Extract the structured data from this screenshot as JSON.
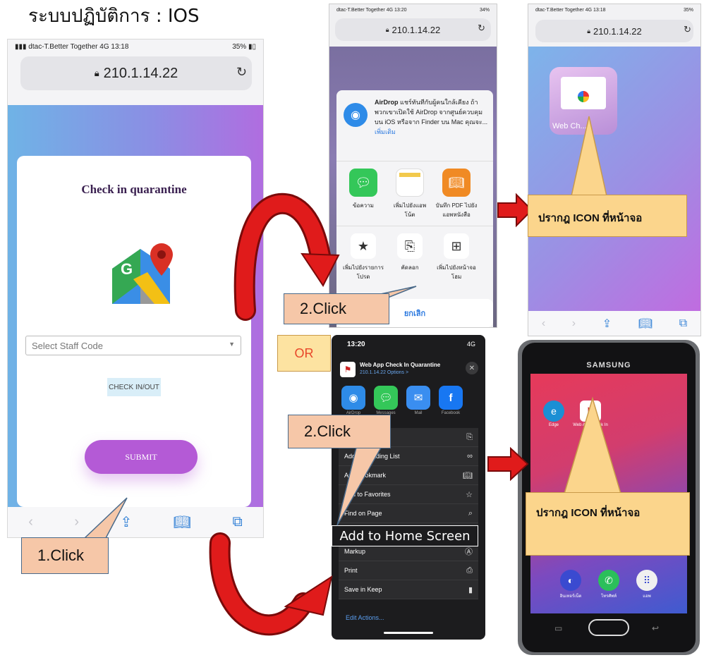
{
  "title": "ระบบปฏิบัติการ : IOS",
  "phone1": {
    "status": {
      "carrier": "dtac-T.Better Together",
      "network": "4G",
      "time": "13:18",
      "battery": "35%"
    },
    "url": "210.1.14.22",
    "card_title": "Check in quarantine",
    "select_placeholder": "Select Staff Code",
    "checkin_button": "CHECK IN/OUT",
    "submit_button": "SUBMIT"
  },
  "phone2": {
    "status": {
      "carrier": "dtac-T.Better Together",
      "network": "4G",
      "time": "13:20",
      "battery": "34%"
    },
    "url": "210.1.14.22",
    "airdrop_title": "AirDrop",
    "airdrop_text": "แชร์ทันทีกับผู้คนใกล้เคียง ถ้าพวกเขาเปิดใช้ AirDrop จากศูนย์ควบคุมบน iOS หรือจาก Finder บน Mac คุณจะ...",
    "airdrop_more": "เพิ่มเติม",
    "apps": [
      {
        "label": "ข้อความ",
        "icon": "messages-icon",
        "color": "#34c759"
      },
      {
        "label": "เพิ่มไปยังแอพโน้ต",
        "icon": "notes-icon",
        "color": "#f2c94c"
      },
      {
        "label": "บันทึก PDF ไปยังแอพหนังสือ",
        "icon": "books-icon",
        "color": "#f08a24"
      }
    ],
    "actions": [
      {
        "label": "เพิ่มไปยังรายการโปรด",
        "icon": "star-icon"
      },
      {
        "label": "คัดลอก",
        "icon": "copy-icon"
      },
      {
        "label": "เพิ่มไปยังหน้าจอโฮม",
        "icon": "add-square-icon"
      }
    ],
    "cancel": "ยกเลิก"
  },
  "phone3": {
    "status": {
      "carrier": "dtac-T.Better Together",
      "network": "4G",
      "time": "13:18",
      "battery": "35%"
    },
    "url": "210.1.14.22",
    "icon_label": "Web Ch..."
  },
  "phone4": {
    "time": "13:20",
    "signal": "4G",
    "app_title": "Web App Check In Quarantine",
    "app_sub": "210.1.14.22 Options >",
    "share_apps": [
      {
        "label": "AirDrop",
        "color": "#2e8be8"
      },
      {
        "label": "Messages",
        "color": "#34c759"
      },
      {
        "label": "Mail",
        "color": "#3a8ef0"
      },
      {
        "label": "Facebook",
        "color": "#1877f2"
      }
    ],
    "menu": [
      {
        "label": "",
        "icon": "copy-icon"
      },
      {
        "label": "Add to Reading List",
        "icon": "glasses-icon"
      },
      {
        "label": "Add Bookmark",
        "icon": "book-icon"
      },
      {
        "label": "Add to Favorites",
        "icon": "star-outline-icon"
      },
      {
        "label": "Find on Page",
        "icon": "search-icon"
      },
      {
        "label": "",
        "icon": ""
      },
      {
        "label": "Markup",
        "icon": "markup-icon"
      },
      {
        "label": "Print",
        "icon": "printer-icon"
      },
      {
        "label": "Save in Keep",
        "icon": "bookmark-icon"
      }
    ],
    "edit_actions": "Edit Actions..."
  },
  "add_home_label": "Add to Home Screen",
  "phone5": {
    "brand": "SAMSUNG",
    "icons": [
      {
        "label": "Edge",
        "icon": "edge-icon",
        "color": "#1b8fd4"
      },
      {
        "label": "Web App Check In Quar...",
        "icon": "web-app-icon",
        "color": "#ffffff"
      }
    ],
    "dock": [
      {
        "label": "อินเทอร์เน็ต",
        "icon": "internet-icon",
        "color": "#3a4ad0"
      },
      {
        "label": "โทรศัพท์",
        "icon": "phone-icon",
        "color": "#2bbf5a"
      },
      {
        "label": "แอพ",
        "icon": "apps-grid-icon",
        "color": "#f0f0f0"
      }
    ]
  },
  "callouts": {
    "click1": "1.Click",
    "click2_top": "2.Click",
    "click2_bottom": "2.Click",
    "or": "OR",
    "icon_appears_top": "ปรากฎ ICON ที่หน้าจอ",
    "icon_appears_bottom": "ปรากฎ ICON ที่หน้าจอ"
  },
  "colors": {
    "arrow_red": "#e01b1b",
    "arrow_dark": "#7a0a0a",
    "callout_yellow": "#fbd58c",
    "callout_tan": "#f6c7a8"
  }
}
